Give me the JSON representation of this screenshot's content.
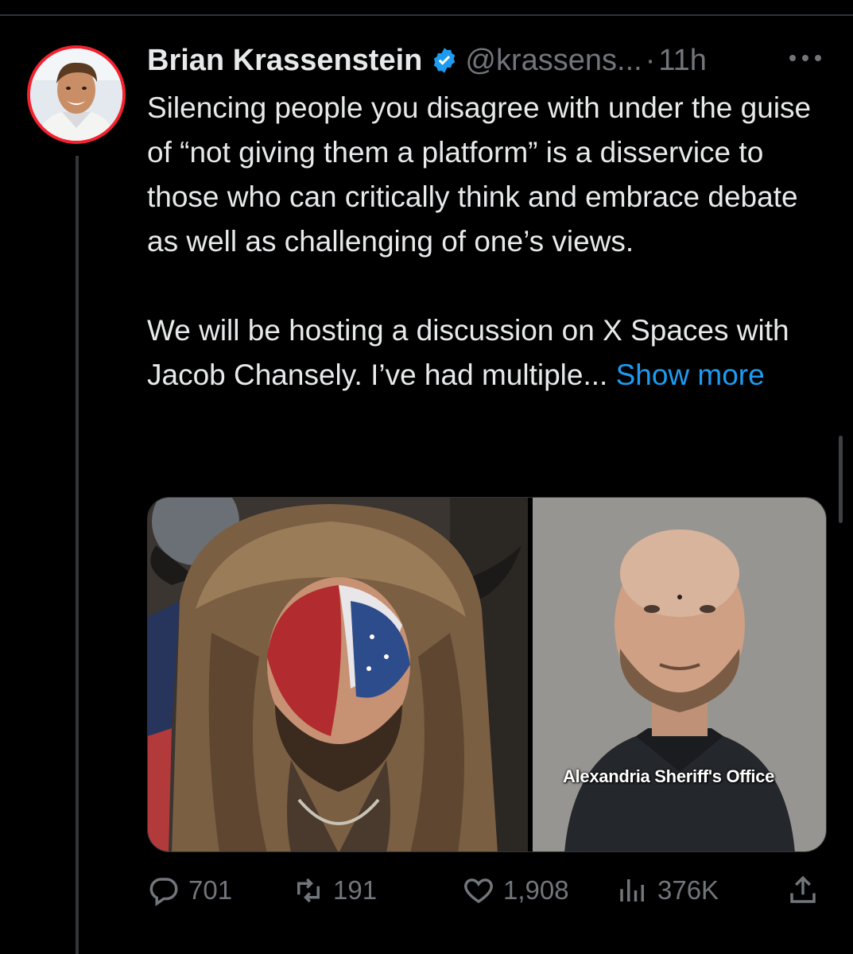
{
  "tweet": {
    "author_name": "Brian Krassenstein",
    "handle": "@krassens...",
    "separator": "·",
    "time": "11h",
    "body_paragraph_1": "Silencing people you disagree with under the guise of “not giving them a platform” is a disservice to those who can critically think and embrace debate as well as challenging of one’s views.",
    "body_paragraph_2_prefix": "We will be hosting a discussion on X Spaces with Jacob Chansely. I’ve had multiple... ",
    "show_more_label": "Show more",
    "media_caption": "Alexandria Sheriff's Office"
  },
  "metrics": {
    "replies": "701",
    "reposts": "191",
    "likes": "1,908",
    "views": "376K"
  },
  "icons": {
    "verified": "verified-badge-icon",
    "more": "more-options-icon",
    "reply": "reply-icon",
    "repost": "repost-icon",
    "like": "heart-icon",
    "views": "views-chart-icon",
    "share": "share-icon"
  },
  "colors": {
    "background": "#000000",
    "text": "#e7e9ea",
    "muted": "#71767b",
    "link": "#1d9bf0",
    "avatar_ring": "#f4212e"
  }
}
